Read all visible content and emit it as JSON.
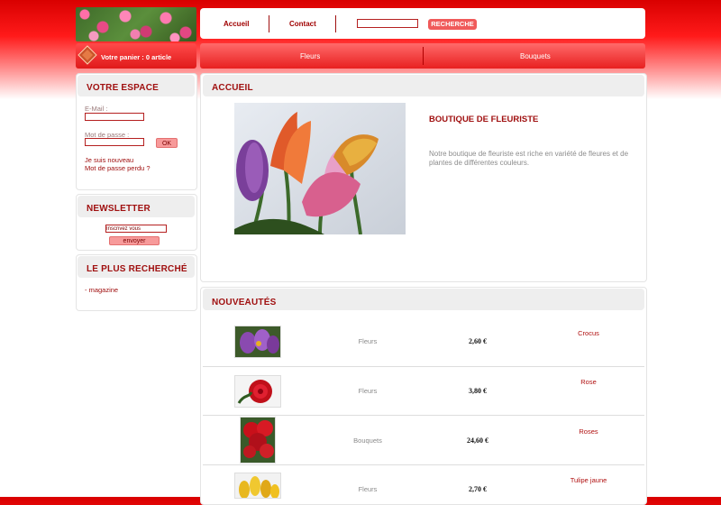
{
  "header": {
    "nav_links": [
      "Accueil",
      "Contact"
    ],
    "search_button": "RECHERCHE",
    "search_value": ""
  },
  "cart": {
    "text": "Votre panier : 0 article"
  },
  "menu": {
    "items": [
      "Fleurs",
      "Bouquets"
    ]
  },
  "account_box": {
    "title": "VOTRE ESPACE",
    "email_label": "E-Mail :",
    "password_label": "Mot de passe :",
    "ok_button": "OK",
    "new_user_link": "Je suis nouveau",
    "lost_password_link": "Mot de passe perdu ?"
  },
  "newsletter_box": {
    "title": "NEWSLETTER",
    "input_value": "Inscrivez vous",
    "send_button": "envoyer"
  },
  "popular_box": {
    "title": "LE PLUS RECHERCHÉ",
    "items": [
      "- magazine"
    ]
  },
  "home": {
    "title": "ACCUEIL",
    "shop_title": "BOUTIQUE DE FLEURISTE",
    "shop_text": "Notre boutique de fleuriste est riche en variété de fleures et de plantes de différentes couleurs."
  },
  "new_products": {
    "title": "NOUVEAUTÉS",
    "products": [
      {
        "category": "Fleurs",
        "price": "2,60 €",
        "name": "Crocus",
        "image": "crocus-photo"
      },
      {
        "category": "Fleurs",
        "price": "3,80 €",
        "name": "Rose",
        "image": "rose-photo"
      },
      {
        "category": "Bouquets",
        "price": "24,60 €",
        "name": "Roses",
        "image": "roses-bouquet-photo"
      },
      {
        "category": "Fleurs",
        "price": "2,70 €",
        "name": "Tulipe jaune",
        "image": "yellow-tulip-photo"
      }
    ]
  }
}
